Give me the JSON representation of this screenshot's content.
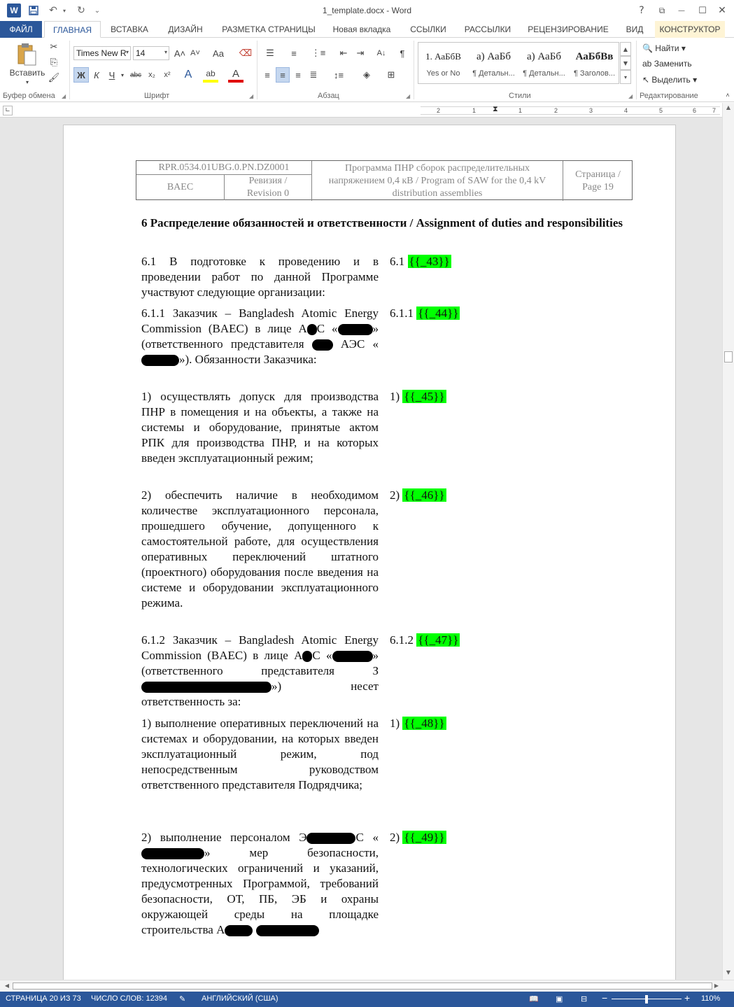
{
  "window": {
    "title": "1_template.docx - Word",
    "help_icon": "?",
    "minimize_icon": "—",
    "maximize_icon": "☐",
    "close_icon": "✕",
    "restore_icon": "⧉"
  },
  "quick_access": {
    "app_icon": "W",
    "save_icon": "💾",
    "undo_icon": "↶",
    "redo_icon": "↻",
    "customize_icon": "⌄"
  },
  "tabs": {
    "file": "ФАЙЛ",
    "home": "ГЛАВНАЯ",
    "insert": "ВСТАВКА",
    "design": "ДИЗАЙН",
    "layout": "РАЗМЕТКА СТРАНИЦЫ",
    "new_tab": "Новая вкладка",
    "references": "ССЫЛКИ",
    "mailings": "РАССЫЛКИ",
    "review": "РЕЦЕНЗИРОВАНИЕ",
    "view": "ВИД",
    "constructor": "КОНСТРУКТОР"
  },
  "ribbon": {
    "clipboard": {
      "paste_label": "Вставить",
      "group_label": "Буфер обмена"
    },
    "font": {
      "font_name": "Times New R",
      "font_size": "14",
      "group_label": "Шрифт",
      "bold": "Ж",
      "italic": "К",
      "underline": "Ч",
      "strike": "abc",
      "subscript": "x₂",
      "superscript": "x²",
      "grow": "A˄",
      "shrink": "A˅",
      "case": "Aa",
      "effects": "A",
      "highlight": "ab",
      "color": "A"
    },
    "paragraph": {
      "group_label": "Абзац",
      "pilcrow": "¶",
      "sort": "A↓"
    },
    "styles": {
      "group_label": "Стили",
      "items": [
        {
          "sample": "1. АаБбВ",
          "name": "Yes or No"
        },
        {
          "sample": "а) АаБб",
          "name": "¶ Детальн..."
        },
        {
          "sample": "а) АаБб",
          "name": "¶ Детальн..."
        },
        {
          "sample": "АаБбВв",
          "name": "¶ Заголов..."
        }
      ]
    },
    "editing": {
      "group_label": "Редактирование",
      "find": "Найти",
      "replace": "Заменить",
      "select": "Выделить"
    }
  },
  "ruler": {
    "numbers": [
      "2",
      "1",
      "1",
      "2",
      "3",
      "4",
      "5",
      "6",
      "7"
    ]
  },
  "doc_header": {
    "code": "RPR.0534.01UBG.0.PN.DZ0001",
    "org": "BAEC",
    "revision": "Ревизия / Revision 0",
    "title": "Программа ПНР сборок распределительных напряжением 0,4 кВ / Program of SAW for the 0,4 kV distribution assemblies",
    "page": "Страница / Page 19"
  },
  "content": {
    "heading": "6 Распределение обязанностей и ответственности / Assignment of duties and responsibilities",
    "p61": "6.1 В подготовке к проведению и в проведении работ по данной Программе участвуют следующие организации:",
    "p61_num": "6.1",
    "p61_tpl": "{{_43}}",
    "p611_a": "6.1.1 Заказчик – Bangladesh Atomic Energy Commission (BAEC) в лице А",
    "p611_b": "С «",
    "p611_c": "» (ответственного представителя ",
    "p611_d": " АЭС «",
    "p611_e": "»). Обязанности Заказчика:",
    "p611_num": "6.1.1",
    "p611_tpl": "{{_44}}",
    "item1": "1) осуществлять допуск для производства ПНР в помещения и на объекты, а также на системы и оборудование, принятые актом РПК для производства ПНР, и на которых введен эксплуатационный режим;",
    "item1_num": "1)",
    "item1_tpl": "{{_45}}",
    "item2": "2) обеспечить наличие в необходимом количестве эксплуатационного персонала, прошедшего обучение, допущенного к самостоятельной работе, для осуществления оперативных переключений штатного (проектного) оборудования после введения на системе и оборудовании эксплуатационного режима.",
    "item2_num": "2)",
    "item2_tpl": "{{_46}}",
    "p612_a": "6.1.2 Заказчик – Bangladesh Atomic Energy Commission (BAEC) в лице А",
    "p612_b": "С «",
    "p612_c": "» (ответственного представителя З",
    "p612_d": "») несет ответственность за:",
    "p612_num": "6.1.2",
    "p612_tpl": "{{_47}}",
    "item3": "1) выполнение оперативных переключений на системах и оборудовании, на которых введен эксплуатационный режим, под непосредственным руководством ответственного представителя Подрядчика;",
    "item3_num": "1)",
    "item3_tpl": "{{_48}}",
    "item4_a": "2) выполнение персоналом Э",
    "item4_b": "С «",
    "item4_c": "» мер безопасности, технологических ограничений и указаний, предусмотренных Программой, требований безопасности, ОТ, ПБ, ЭБ и охраны окружающей среды на площадке строительства А",
    "item4_num": "2)",
    "item4_tpl": "{{_49}}"
  },
  "status": {
    "page": "СТРАНИЦА 20 ИЗ 73",
    "words": "ЧИСЛО СЛОВ: 12394",
    "language": "АНГЛИЙСКИЙ (США)",
    "zoom": "110%",
    "zoom_minus": "−",
    "zoom_plus": "+"
  }
}
